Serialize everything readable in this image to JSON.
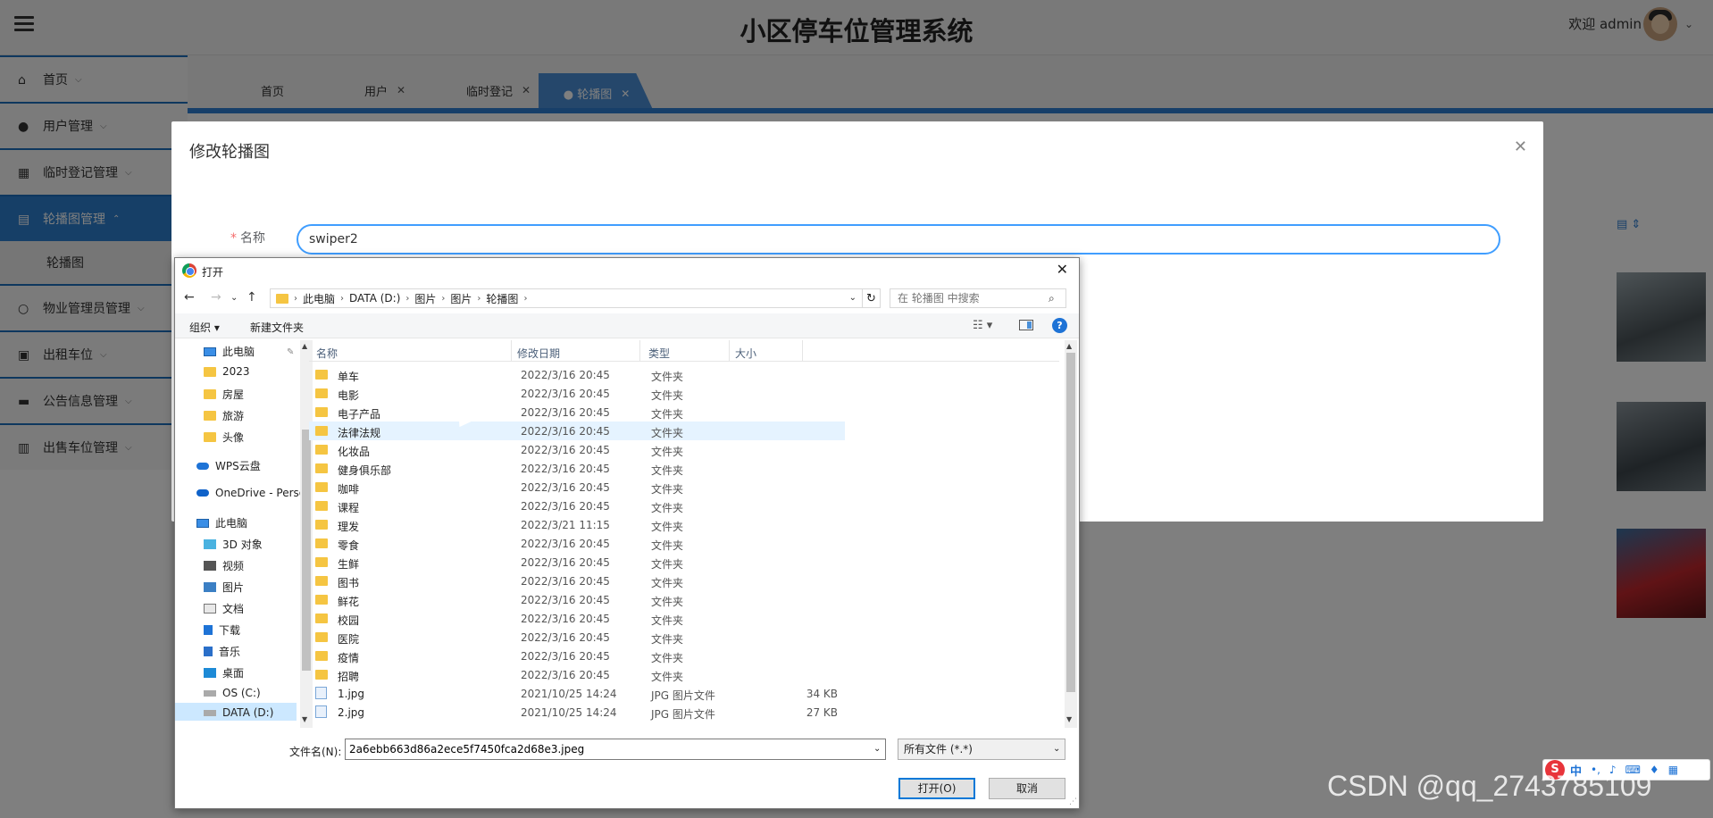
{
  "app": {
    "title": "小区停车位管理系统",
    "welcome": "欢迎 admin"
  },
  "sidebar": {
    "items": [
      {
        "label": "首页",
        "icon": "home-icon"
      },
      {
        "label": "用户管理",
        "icon": "user-icon"
      },
      {
        "label": "临时登记管理",
        "icon": "table-icon"
      },
      {
        "label": "轮播图管理",
        "icon": "book-icon",
        "active": true
      },
      {
        "label": "物业管理员管理",
        "icon": "user-outline-icon"
      },
      {
        "label": "出租车位",
        "icon": "grid-icon"
      },
      {
        "label": "公告信息管理",
        "icon": "shop-icon"
      },
      {
        "label": "出售车位管理",
        "icon": "bar-chart-icon"
      }
    ],
    "sub_item": "轮播图"
  },
  "tabs": [
    {
      "label": "首页"
    },
    {
      "label": "用户"
    },
    {
      "label": "临时登记"
    },
    {
      "label": "● 轮播图",
      "active": true
    }
  ],
  "modal": {
    "title": "修改轮播图",
    "field_label": "名称",
    "field_value": "swiper2"
  },
  "dialog": {
    "title": "打开",
    "breadcrumb": [
      "此电脑",
      "DATA (D:)",
      "图片",
      "图片",
      "轮播图"
    ],
    "search_placeholder": "在 轮播图 中搜索",
    "toolbar": {
      "organize": "组织 ▾",
      "new_folder": "新建文件夹"
    },
    "tree": [
      {
        "label": "此电脑",
        "icon": "pc-icon"
      },
      {
        "label": "2023",
        "icon": "folder-icon"
      },
      {
        "label": "房屋",
        "icon": "folder-icon"
      },
      {
        "label": "旅游",
        "icon": "folder-icon"
      },
      {
        "label": "头像",
        "icon": "folder-icon"
      },
      {
        "label": "WPS云盘",
        "icon": "cloud-icon"
      },
      {
        "label": "OneDrive - Perso",
        "icon": "onedrive-icon"
      },
      {
        "label": "此电脑",
        "icon": "pc-icon"
      },
      {
        "label": "3D 对象",
        "icon": "3d-objects-icon"
      },
      {
        "label": "视频",
        "icon": "video-icon"
      },
      {
        "label": "图片",
        "icon": "pictures-icon"
      },
      {
        "label": "文档",
        "icon": "documents-icon"
      },
      {
        "label": "下载",
        "icon": "download-icon"
      },
      {
        "label": "音乐",
        "icon": "music-icon"
      },
      {
        "label": "桌面",
        "icon": "desktop-icon"
      },
      {
        "label": "OS (C:)",
        "icon": "drive-icon"
      },
      {
        "label": "DATA (D:)",
        "icon": "drive-icon",
        "selected": true
      }
    ],
    "columns": {
      "name": "名称",
      "date": "修改日期",
      "type": "类型",
      "size": "大小"
    },
    "files": [
      {
        "name": "单车",
        "date": "2022/3/16 20:45",
        "type": "文件夹",
        "size": ""
      },
      {
        "name": "电影",
        "date": "2022/3/16 20:45",
        "type": "文件夹",
        "size": ""
      },
      {
        "name": "电子产品",
        "date": "2022/3/16 20:45",
        "type": "文件夹",
        "size": ""
      },
      {
        "name": "法律法规",
        "date": "2022/3/16 20:45",
        "type": "文件夹",
        "size": "",
        "hover": true
      },
      {
        "name": "化妆品",
        "date": "2022/3/16 20:45",
        "type": "文件夹",
        "size": ""
      },
      {
        "name": "健身俱乐部",
        "date": "2022/3/16 20:45",
        "type": "文件夹",
        "size": ""
      },
      {
        "name": "咖啡",
        "date": "2022/3/16 20:45",
        "type": "文件夹",
        "size": ""
      },
      {
        "name": "课程",
        "date": "2022/3/16 20:45",
        "type": "文件夹",
        "size": ""
      },
      {
        "name": "理发",
        "date": "2022/3/21 11:15",
        "type": "文件夹",
        "size": ""
      },
      {
        "name": "零食",
        "date": "2022/3/16 20:45",
        "type": "文件夹",
        "size": ""
      },
      {
        "name": "生鲜",
        "date": "2022/3/16 20:45",
        "type": "文件夹",
        "size": ""
      },
      {
        "name": "图书",
        "date": "2022/3/16 20:45",
        "type": "文件夹",
        "size": ""
      },
      {
        "name": "鲜花",
        "date": "2022/3/16 20:45",
        "type": "文件夹",
        "size": ""
      },
      {
        "name": "校园",
        "date": "2022/3/16 20:45",
        "type": "文件夹",
        "size": ""
      },
      {
        "name": "医院",
        "date": "2022/3/16 20:45",
        "type": "文件夹",
        "size": ""
      },
      {
        "name": "疫情",
        "date": "2022/3/16 20:45",
        "type": "文件夹",
        "size": ""
      },
      {
        "name": "招聘",
        "date": "2022/3/16 20:45",
        "type": "文件夹",
        "size": ""
      },
      {
        "name": "1.jpg",
        "date": "2021/10/25 14:24",
        "type": "JPG 图片文件",
        "size": "34 KB"
      },
      {
        "name": "2.jpg",
        "date": "2021/10/25 14:24",
        "type": "JPG 图片文件",
        "size": "27 KB"
      }
    ],
    "filename_label": "文件名(N):",
    "filename_value": "2a6ebb663d86a2ece5f7450fca2d68e3.jpeg",
    "filetype": "所有文件 (*.*)",
    "open_label": "打开(O)",
    "cancel_label": "取消"
  },
  "ime": {
    "label": "中"
  },
  "watermark": "CSDN @qq_2743785109"
}
